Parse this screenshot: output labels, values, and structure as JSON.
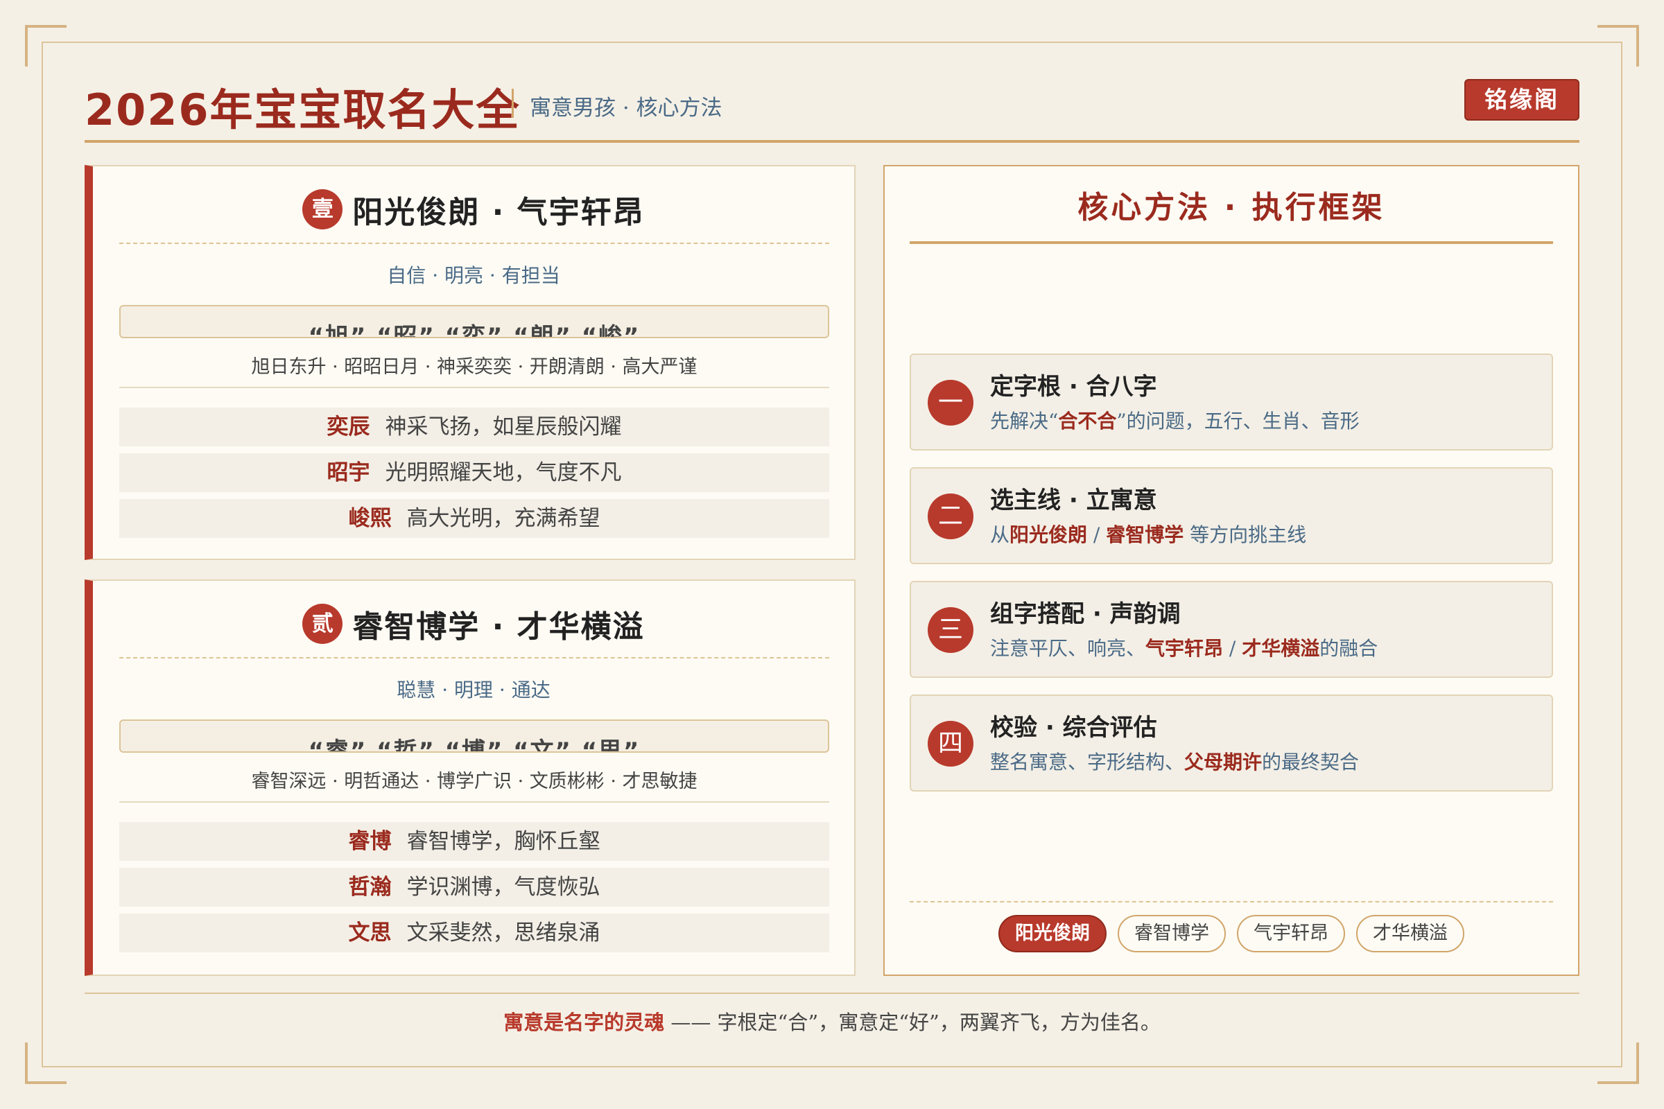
{
  "header": {
    "title": "2026年宝宝取名大全",
    "subtitle": "寓意男孩 · 核心方法",
    "brand": "铭缘阁"
  },
  "cards": [
    {
      "badge": "壹",
      "title": "阳光俊朗 · 气宇轩昂",
      "subtitle": "自信 · 明亮 · 有担当",
      "chars": "“旭” “昭” “奕” “朗” “峻”",
      "phrases": "旭日东升 · 昭昭日月 · 神采奕奕 · 开朗清朗 · 高大严谨",
      "names": [
        {
          "name": "奕辰",
          "desc": "神采飞扬，如星辰般闪耀"
        },
        {
          "name": "昭宇",
          "desc": "光明照耀天地，气度不凡"
        },
        {
          "name": "峻熙",
          "desc": "高大光明，充满希望"
        }
      ]
    },
    {
      "badge": "贰",
      "title": "睿智博学 · 才华横溢",
      "subtitle": "聪慧 · 明理 · 通达",
      "chars": "“睿” “哲” “博” “文” “思”",
      "phrases": "睿智深远 · 明哲通达 · 博学广识 · 文质彬彬 · 才思敏捷",
      "names": [
        {
          "name": "睿博",
          "desc": "睿智博学，胸怀丘壑"
        },
        {
          "name": "哲瀚",
          "desc": "学识渊博，气度恢弘"
        },
        {
          "name": "文思",
          "desc": "文采斐然，思绪泉涌"
        }
      ]
    }
  ],
  "panel": {
    "title": "核心方法 · 执行框架",
    "steps": [
      {
        "num": "一",
        "title": "定字根 · 合八字",
        "desc_pre": "先解决“",
        "desc_hl1": "合不合",
        "desc_mid": "”的问题，五行、生肖、音形",
        "desc_hl2": "",
        "desc_post": ""
      },
      {
        "num": "二",
        "title": "选主线 · 立寓意",
        "desc_pre": "从",
        "desc_hl1": "阳光俊朗",
        "desc_mid": " / ",
        "desc_hl2": "睿智博学",
        "desc_post": " 等方向挑主线"
      },
      {
        "num": "三",
        "title": "组字搭配 · 声韵调",
        "desc_pre": "注意平仄、响亮、",
        "desc_hl1": "气宇轩昂",
        "desc_mid": " / ",
        "desc_hl2": "才华横溢",
        "desc_post": "的融合"
      },
      {
        "num": "四",
        "title": "校验 · 综合评估",
        "desc_pre": "整名寓意、字形结构、",
        "desc_hl1": "父母期许",
        "desc_mid": "的最终契合",
        "desc_hl2": "",
        "desc_post": ""
      }
    ],
    "tags": [
      "阳光俊朗",
      "睿智博学",
      "气宇轩昂",
      "才华横溢"
    ]
  },
  "footer": {
    "highlight": "寓意是名字的灵魂",
    "text": " —— 字根定“合”，寓意定“好”，两翼齐飞，方为佳名。"
  },
  "colors": {
    "accent": "#b83a2c",
    "title": "#9b2a1e",
    "gold": "#d2a56a",
    "background": "#f5f0e6"
  }
}
